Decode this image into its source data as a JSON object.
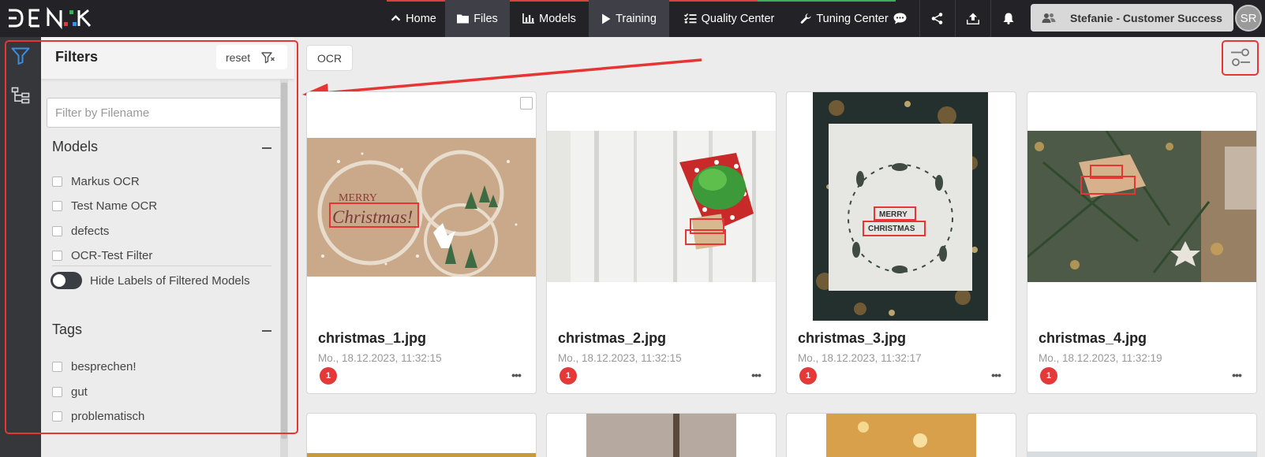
{
  "nav": {
    "items": [
      {
        "label": "Home",
        "icon": "chevron-up-icon"
      },
      {
        "label": "Files",
        "icon": "folder-icon"
      },
      {
        "label": "Models",
        "icon": "bar-chart-icon"
      },
      {
        "label": "Training",
        "icon": "play-icon"
      },
      {
        "label": "Quality Center",
        "icon": "list-check-icon"
      },
      {
        "label": "Tuning Center",
        "icon": "wrench-icon"
      }
    ],
    "icons": [
      "chat-icon",
      "share-icon",
      "upload-icon",
      "bell-icon"
    ],
    "accent_colors": {
      "red": "#d94040",
      "green": "#3fae5a"
    }
  },
  "user": {
    "name": "Stefanie - Customer Success",
    "initials": "SR",
    "icon": "users-icon"
  },
  "sidebar": {
    "rail_icons": [
      "filter-icon",
      "tree-icon"
    ]
  },
  "filters": {
    "title": "Filters",
    "reset_label": "reset",
    "search_placeholder": "Filter by Filename",
    "models_title": "Models",
    "models": [
      "Markus OCR",
      "Test Name OCR",
      "defects",
      "OCR-Test Filter"
    ],
    "hide_labels_toggle": "Hide Labels of Filtered Models",
    "tags_title": "Tags",
    "tags": [
      "besprechen!",
      "gut",
      "problematisch"
    ]
  },
  "active_chip": "OCR",
  "files": [
    {
      "name": "christmas_1.jpg",
      "date": "Mo., 18.12.2023, 11:32:15",
      "count": "1"
    },
    {
      "name": "christmas_2.jpg",
      "date": "Mo., 18.12.2023, 11:32:15",
      "count": "1"
    },
    {
      "name": "christmas_3.jpg",
      "date": "Mo., 18.12.2023, 11:32:17",
      "count": "1"
    },
    {
      "name": "christmas_4.jpg",
      "date": "Mo., 18.12.2023, 11:32:19",
      "count": "1"
    }
  ],
  "more_label": "•••",
  "colors": {
    "accent_blue": "#3b8fe0",
    "annotation_red": "#e53535",
    "badge_red": "#e53838"
  }
}
